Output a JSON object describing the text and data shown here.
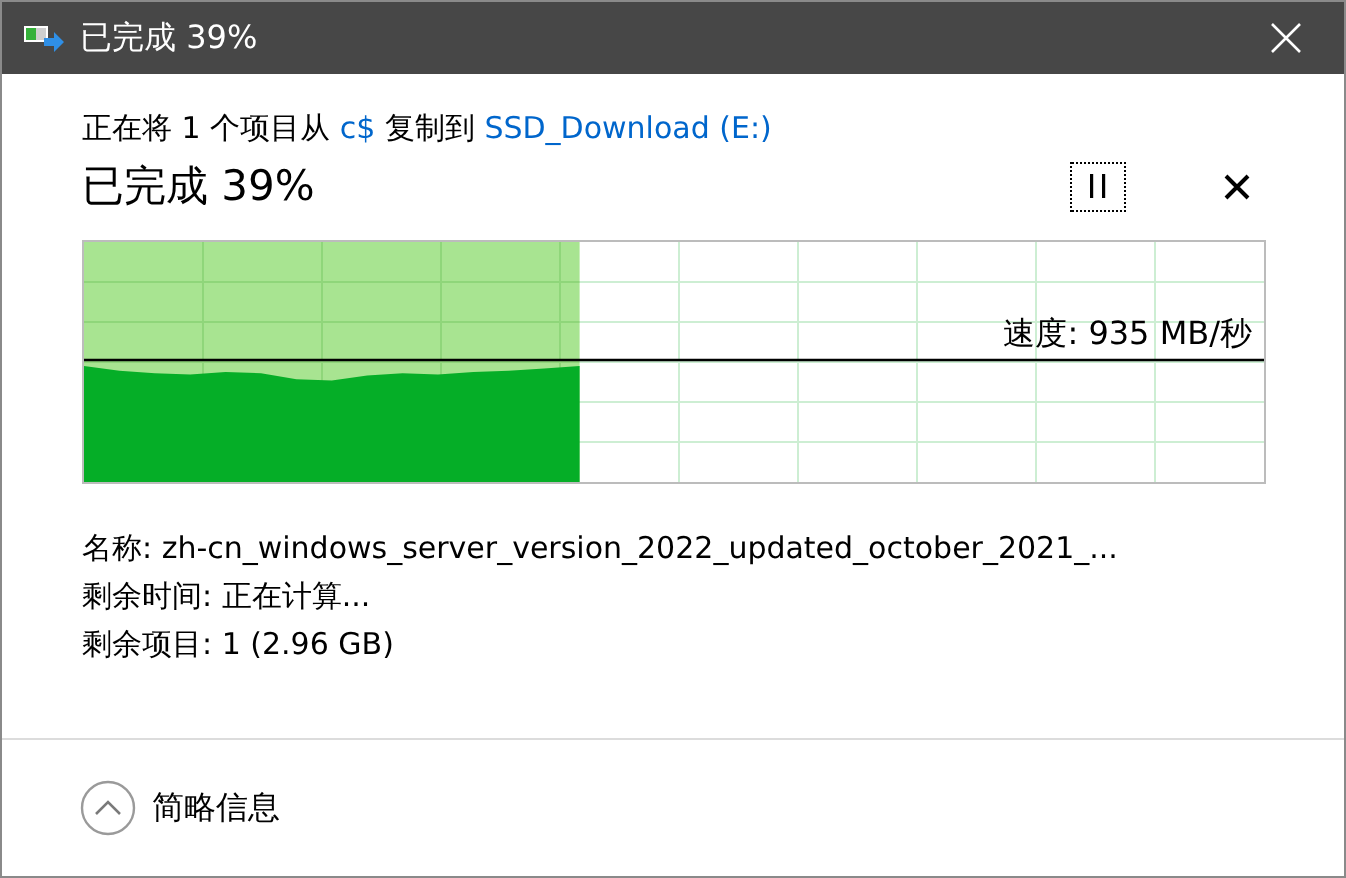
{
  "window": {
    "title": "已完成 39%"
  },
  "header": {
    "parts": [
      {
        "kind": "text",
        "text": "正在将 1 个项目从 "
      },
      {
        "kind": "link",
        "text": "c$"
      },
      {
        "kind": "text",
        "text": " 复制到 "
      },
      {
        "kind": "link",
        "text": "SSD_Download (E:)"
      }
    ]
  },
  "status": "已完成 39%",
  "graph": {
    "level": 0.42,
    "speed": "速度: 935 MB/秒"
  },
  "details": [
    "名称: zh-cn_windows_server_version_2022_updated_october_2021_...",
    "剩余时间: 正在计算...",
    "剩余项目: 1 (2.96 GB)"
  ],
  "footer": {
    "label": "简略信息",
    "expanded": true
  }
}
